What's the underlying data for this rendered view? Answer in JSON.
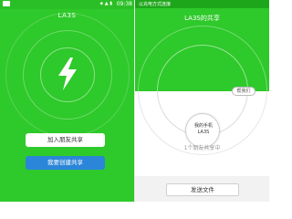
{
  "left_screen": {
    "status_time": "09:38",
    "status_icons": "◈ ▲ ▮",
    "title": "LA3S",
    "buttons": {
      "join": "加入朋友共享",
      "create": "我要创建共享"
    },
    "colors": {
      "background": "#2ec92a",
      "create_button": "#2b86d9"
    }
  },
  "right_screen": {
    "status_text": "以充电方式连接",
    "title": "LA3S的共享",
    "help_pill": "帮我们",
    "device": {
      "line1": "我的手机",
      "line2": "LA3S"
    },
    "friends_status": "1个朋友共享中",
    "send_button": "发送文件"
  },
  "icons": {
    "center": "lightning-bolt-icon"
  }
}
